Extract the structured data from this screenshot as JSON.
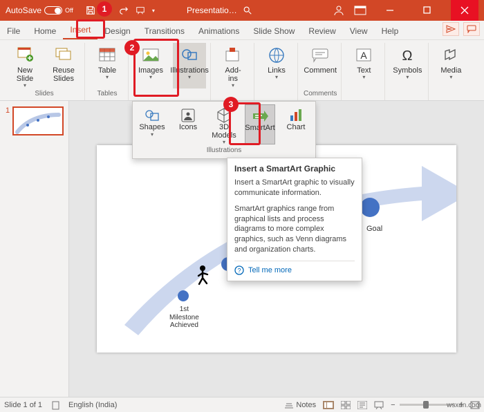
{
  "titlebar": {
    "autosave_label": "AutoSave",
    "autosave_state": "Off",
    "doc_title": "Presentatio…"
  },
  "tabs": {
    "file": "File",
    "home": "Home",
    "insert": "Insert",
    "design": "Design",
    "transitions": "Transitions",
    "animations": "Animations",
    "slideshow": "Slide Show",
    "review": "Review",
    "view": "View",
    "help": "Help"
  },
  "ribbon": {
    "new_slide": "New\nSlide",
    "reuse_slides": "Reuse\nSlides",
    "slides_group": "Slides",
    "table": "Table",
    "tables_group": "Tables",
    "images": "Images",
    "illustrations": "Illustrations",
    "addins": "Add-\nins",
    "links": "Links",
    "comment": "Comment",
    "comments_group": "Comments",
    "text": "Text",
    "symbols": "Symbols",
    "media": "Media"
  },
  "gallery": {
    "shapes": "Shapes",
    "icons": "Icons",
    "models": "3D\nModels",
    "smartart": "SmartArt",
    "chart": "Chart",
    "label": "Illustrations"
  },
  "tooltip": {
    "title": "Insert a SmartArt Graphic",
    "p1": "Insert a SmartArt graphic to visually communicate information.",
    "p2": "SmartArt graphics range from graphical lists and process diagrams to more complex graphics, such as Venn diagrams and organization charts.",
    "tell_me": "Tell me more"
  },
  "slide": {
    "goal": "Goal",
    "milestone": "1st\nMilestone\nAchieved"
  },
  "thumb_num": "1",
  "status": {
    "slide": "Slide 1 of 1",
    "lang": "English (India)",
    "notes": "Notes"
  },
  "callouts": {
    "c1": "1",
    "c2": "2",
    "c3": "3"
  },
  "watermark": "wsxdn.com"
}
